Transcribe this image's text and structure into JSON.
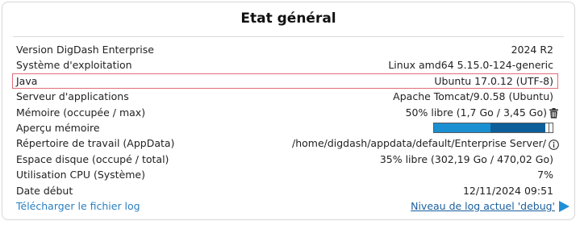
{
  "panel": {
    "title": "Etat général"
  },
  "rows": [
    {
      "label": "Version DigDash Enterprise",
      "value": "2024 R2"
    },
    {
      "label": "Système d'exploitation",
      "value": "Linux amd64 5.15.0-124-generic"
    },
    {
      "label": "Java",
      "value": "Ubuntu 17.0.12 (UTF-8)"
    },
    {
      "label": "Serveur d'applications",
      "value": "Apache Tomcat/9.0.58 (Ubuntu)"
    },
    {
      "label": "Mémoire (occupée / max)",
      "value": "50% libre (1,7 Go / 3,45 Go)"
    },
    {
      "label": "Aperçu mémoire"
    },
    {
      "label": "Répertoire de travail (AppData)",
      "value": "/home/digdash/appdata/default/Enterprise Server/"
    },
    {
      "label": "Espace disque (occupé / total)",
      "value": "35% libre (302,19 Go / 470,02 Go)"
    },
    {
      "label": "Utilisation CPU (Système)",
      "value": "7%"
    },
    {
      "label": "Date début",
      "value": "12/11/2024 09:51"
    }
  ],
  "memory_preview": {
    "free_fraction": 0.49,
    "used_fraction": 0.48,
    "colors": {
      "free": "#1a8fd1",
      "used": "#0d5f99"
    }
  },
  "footer": {
    "download_log_link": "Télécharger le fichier log",
    "log_level_link": "Niveau de log actuel 'debug'"
  },
  "colors": {
    "link": "#2a7fc1",
    "highlight_border": "#e26d78",
    "play_icon": "#1f8fd6"
  },
  "icons": {
    "trash": "trash-icon",
    "info": "info-icon",
    "play": "play-icon"
  }
}
